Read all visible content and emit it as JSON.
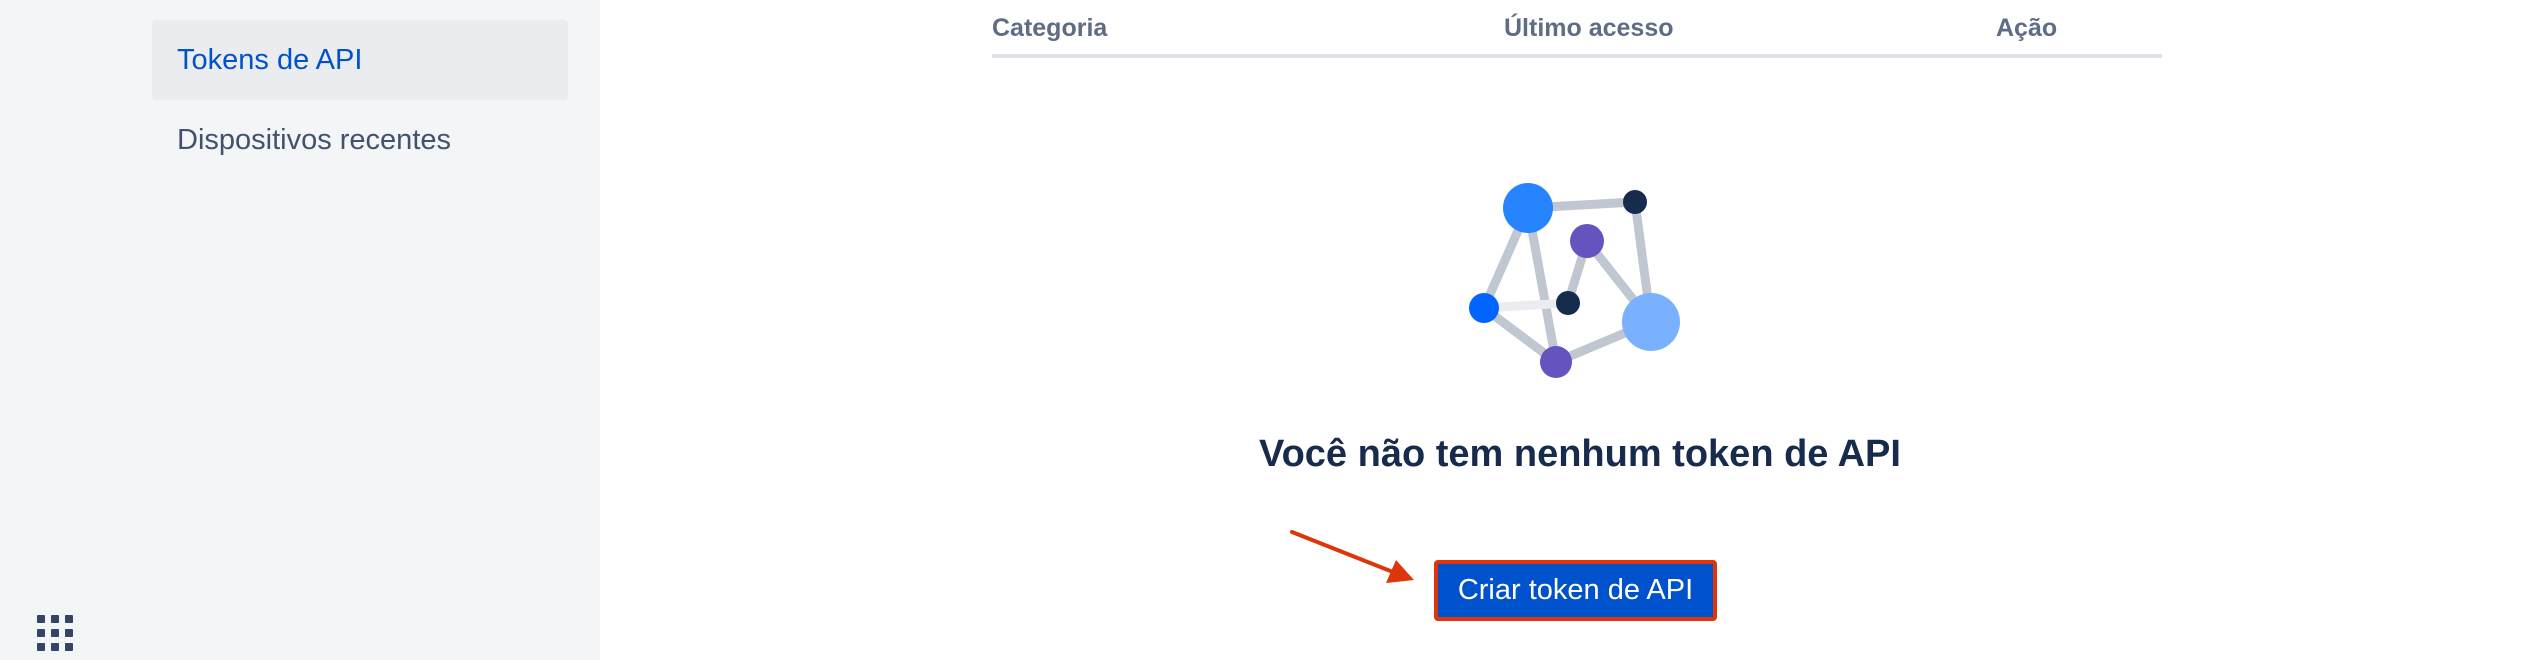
{
  "sidebar": {
    "items": [
      {
        "label": "Tokens de API",
        "active": true
      },
      {
        "label": "Dispositivos recentes",
        "active": false
      }
    ],
    "apps_icon": "app-switcher-grid-icon"
  },
  "table": {
    "columns": [
      "Categoria",
      "Último acesso",
      "Ação"
    ]
  },
  "empty_state": {
    "illustration_icon": "network-nodes-illustration",
    "title": "Você não tem nenhum token de API",
    "button_label": "Criar token de API"
  },
  "annotation": {
    "arrow_icon": "red-arrow-icon",
    "highlight_color": "#de350b"
  },
  "colors": {
    "primary": "#0052cc",
    "sidebar_bg": "#f4f5f7",
    "text_dark": "#172b4d",
    "text_muted": "#5e6c84"
  }
}
